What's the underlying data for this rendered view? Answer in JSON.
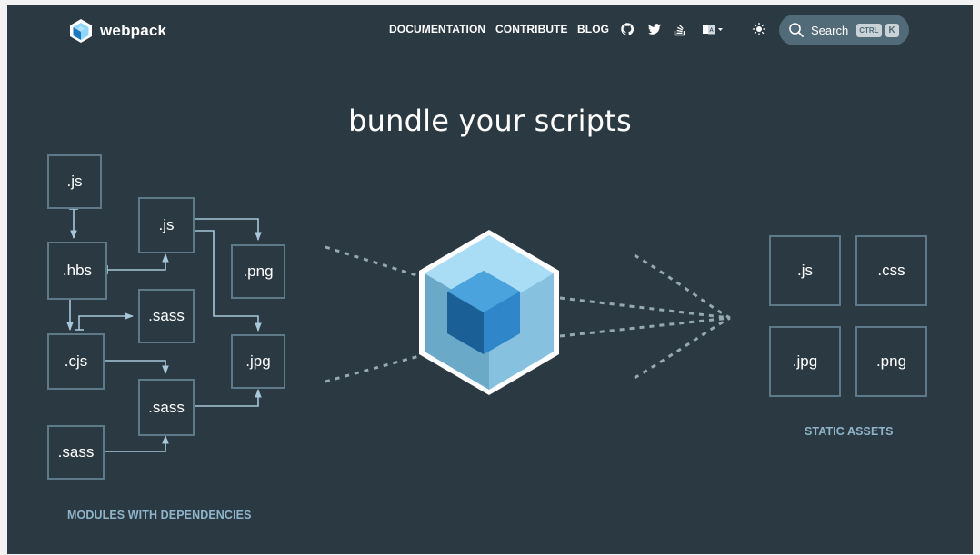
{
  "header": {
    "logo_text": "webpack",
    "nav": {
      "documentation": "DOCUMENTATION",
      "contribute": "CONTRIBUTE",
      "blog": "BLOG"
    },
    "icons": [
      "github-icon",
      "twitter-icon",
      "stackoverflow-icon",
      "language-icon",
      "theme-toggle-icon"
    ],
    "search": {
      "label": "Search",
      "shortcut_ctrl": "CTRL",
      "shortcut_key": "K"
    }
  },
  "hero": {
    "title": "bundle your scripts"
  },
  "modules": {
    "caption": "MODULES WITH DEPENDENCIES",
    "boxes": [
      ".js",
      ".hbs",
      ".cjs",
      ".sass",
      ".js",
      ".sass",
      ".sass",
      ".png",
      ".jpg"
    ]
  },
  "assets": {
    "caption": "STATIC ASSETS",
    "boxes": [
      ".js",
      ".css",
      ".jpg",
      ".png"
    ]
  },
  "colors": {
    "background": "#2b3a42",
    "box_border": "#5e7a89",
    "arrow": "#a7c7d8",
    "caption": "#8fb4c9",
    "cube_outer": "#8ed6fb",
    "cube_inner": "#1c78c0"
  }
}
